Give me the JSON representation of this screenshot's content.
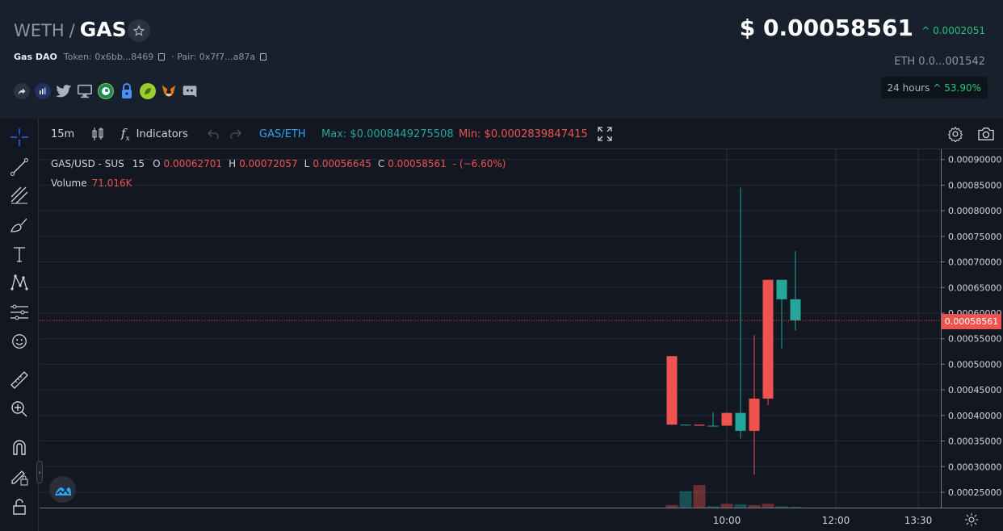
{
  "header": {
    "base_symbol": "WETH",
    "separator": "/",
    "quote_symbol": "GAS",
    "project_name": "Gas DAO",
    "token_label": "Token: 0x6bb...8469",
    "pair_label": "· Pair: 0x7f7...a87a",
    "price": "$ 0.00058561",
    "price_change": "^ 0.0002051",
    "eth_price": "ETH  0.0...001542",
    "h24_label": "24 hours",
    "h24_change": "^ 53.90%",
    "socials": [
      "share-icon",
      "etherscan-icon",
      "twitter-icon",
      "website-icon",
      "coingecko-icon",
      "lock-icon",
      "dextools-icon",
      "metamask-icon",
      "discord-icon"
    ]
  },
  "toolbar": {
    "interval": "15m",
    "indicators_label": "Indicators",
    "pair_toggle": "GAS/ETH",
    "max_label": "Max: $0.0008449275508",
    "min_label": "Min: $0.0002839847415"
  },
  "legend": {
    "symbol": "GAS/USD - SUS",
    "interval": "15",
    "o_label": "O",
    "o_value": "0.00062701",
    "h_label": "H",
    "h_value": "0.00072057",
    "l_label": "L",
    "l_value": "0.00056645",
    "c_label": "C",
    "c_value": "0.00058561",
    "change": "- (−6.60%)",
    "volume_label": "Volume",
    "volume_value": "71.016K"
  },
  "current_price_tag": "0.00058561",
  "colors": {
    "up": "#26a69a",
    "down": "#ef5350",
    "up_bright": "#26c281",
    "accent_blue": "#2962ff"
  },
  "chart_data": {
    "type": "candlestick",
    "x": [
      "09:15",
      "09:30",
      "09:45",
      "10:00",
      "10:15",
      "10:30",
      "10:45",
      "11:00",
      "11:15",
      "11:30"
    ],
    "series": [
      {
        "open": [
          0.000516,
          0.000382,
          0.000382,
          0.00038,
          0.000405,
          0.00037,
          0.000433,
          0.000665,
          0.000627,
          0.000586
        ],
        "high": [
          0.000516,
          0.000382,
          0.000382,
          0.000406,
          0.000406,
          0.000845,
          0.000557,
          0.000665,
          0.000665,
          0.000721
        ],
        "low": [
          0.000381,
          0.00038,
          0.00038,
          0.00038,
          0.00038,
          0.000355,
          0.000284,
          0.00042,
          0.00053,
          0.000566
        ],
        "close": [
          0.000382,
          0.000382,
          0.00038,
          0.00038,
          0.00038,
          0.000405,
          0.00037,
          0.000433,
          0.000665,
          0.000627
        ]
      },
      {
        "name": "Volume",
        "values": [
          4,
          26,
          36,
          2,
          6,
          5,
          4,
          6,
          2,
          1
        ]
      }
    ],
    "ylim": [
      0.00022,
      0.00092
    ],
    "yticks": [
      "0.00090000",
      "0.00085000",
      "0.00080000",
      "0.00075000",
      "0.00070000",
      "0.00065000",
      "0.00060000",
      "0.00055000",
      "0.00050000",
      "0.00045000",
      "0.00040000",
      "0.00035000",
      "0.00030000",
      "0.00025000"
    ],
    "xticks": [
      "10:00",
      "12:00",
      "13:30"
    ],
    "grid": true
  }
}
